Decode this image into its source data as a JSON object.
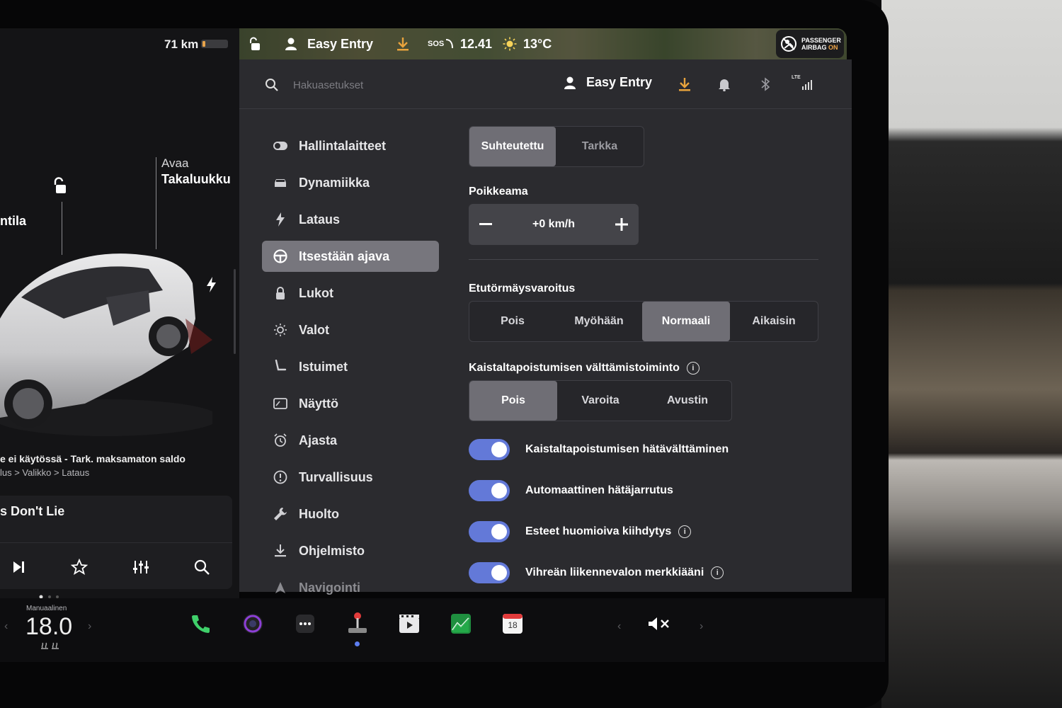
{
  "left": {
    "range": "71 km",
    "trunk_action": "Avaa",
    "trunk_name": "Takaluukku",
    "mode_fragment": "ntila",
    "alert_text": "e ei käytössä - Tark. maksamaton saldo",
    "alert_path": "lus > Valikko > Lataus",
    "song": "s Don't Lie"
  },
  "status": {
    "profile": "Easy Entry",
    "sos": "SOS",
    "time": "12.41",
    "temperature": "13°C",
    "airbag_line1": "PASSENGER",
    "airbag_line2_a": "AIRBAG ",
    "airbag_line2_b": "ON"
  },
  "topbar": {
    "search_placeholder": "Hakuasetukset",
    "profile": "Easy Entry",
    "signal": "LTE"
  },
  "nav": [
    {
      "label": "Hallintalaitteet",
      "icon": "toggle-icon"
    },
    {
      "label": "Dynamiikka",
      "icon": "car-icon"
    },
    {
      "label": "Lataus",
      "icon": "bolt-icon"
    },
    {
      "label": "Itsestään ajava",
      "icon": "steering-wheel-icon",
      "active": true
    },
    {
      "label": "Lukot",
      "icon": "lock-icon"
    },
    {
      "label": "Valot",
      "icon": "sun-icon"
    },
    {
      "label": "Istuimet",
      "icon": "seat-icon"
    },
    {
      "label": "Näyttö",
      "icon": "display-icon"
    },
    {
      "label": "Ajasta",
      "icon": "alarm-icon"
    },
    {
      "label": "Turvallisuus",
      "icon": "alert-circle-icon"
    },
    {
      "label": "Huolto",
      "icon": "wrench-icon"
    },
    {
      "label": "Ohjelmisto",
      "icon": "download-icon"
    },
    {
      "label": "Navigointi",
      "icon": "navigation-icon"
    }
  ],
  "content": {
    "speed_mode": {
      "options": [
        "Suhteutettu",
        "Tarkka"
      ],
      "selected": "Suhteutettu"
    },
    "offset_label": "Poikkeama",
    "offset_value": "+0 km/h",
    "fcw_label": "Etutörmäysvaroitus",
    "fcw": {
      "options": [
        "Pois",
        "Myöhään",
        "Normaali",
        "Aikaisin"
      ],
      "selected": "Normaali"
    },
    "lane_label": "Kaistaltapoistumisen välttämistoiminto",
    "lane": {
      "options": [
        "Pois",
        "Varoita",
        "Avustin"
      ],
      "selected": "Pois"
    },
    "toggles": [
      {
        "label": "Kaistaltapoistumisen hätävälttäminen",
        "on": true,
        "info": false
      },
      {
        "label": "Automaattinen hätäjarrutus",
        "on": true,
        "info": false
      },
      {
        "label": "Esteet huomioiva kiihdytys",
        "on": true,
        "info": true
      },
      {
        "label": "Vihreän liikennevalon merkkiääni",
        "on": true,
        "info": true
      }
    ]
  },
  "dock": {
    "climate_label": "Manuaalinen",
    "temperature": "18.0",
    "calendar_day": "18"
  },
  "colors": {
    "accent": "#6379d8",
    "panel": "#2b2b2f",
    "selected": "#6f6e75",
    "download": "#e8a33c"
  }
}
